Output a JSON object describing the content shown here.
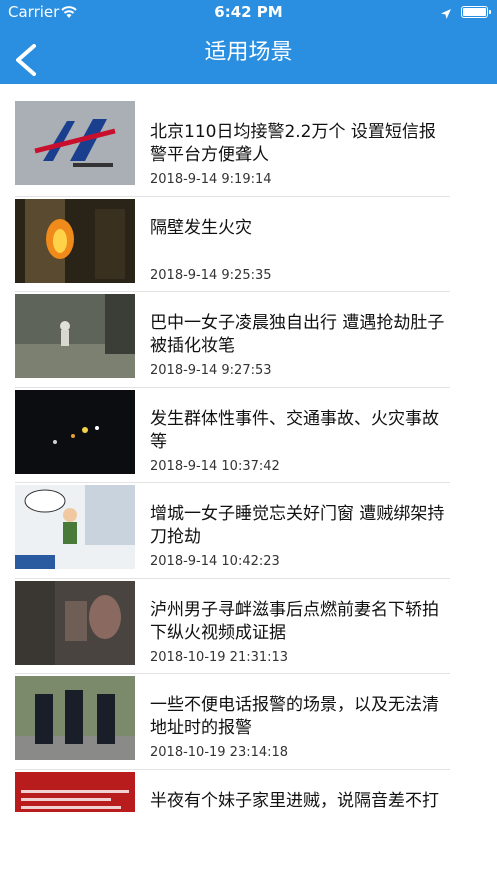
{
  "status_bar": {
    "carrier": "Carrier",
    "time": "6:42 PM"
  },
  "nav": {
    "title": "适用场景",
    "back_icon": "chevron-left-icon"
  },
  "colors": {
    "nav_bar": "#2a8fe0",
    "text": "#111111",
    "date": "#333333",
    "separator": "#e3e3e3"
  },
  "items": [
    {
      "title": "北京110日均接警2.2万个 设置短信报警平台方便聋人",
      "date": "2018-9-14 9:19:14"
    },
    {
      "title": "隔壁发生火灾",
      "date": "2018-9-14 9:25:35"
    },
    {
      "title": "巴中一女子凌晨独自出行 遭遇抢劫肚子被插化妆笔",
      "date": "2018-9-14 9:27:53"
    },
    {
      "title": "发生群体性事件、交通事故、火灾事故等",
      "date": "2018-9-14 10:37:42"
    },
    {
      "title": "增城一女子睡觉忘关好门窗 遭贼绑架持刀抢劫",
      "date": "2018-9-14 10:42:23"
    },
    {
      "title": "泸州男子寻衅滋事后点燃前妻名下轿拍下纵火视频成证据",
      "date": "2018-10-19 21:31:13"
    },
    {
      "title": "一些不便电话报警的场景，以及无法清地址时的报警",
      "date": "2018-10-19 23:14:18"
    },
    {
      "title": "半夜有个妹子家里进贼，说隔音差不打电话报警",
      "date": ""
    }
  ]
}
